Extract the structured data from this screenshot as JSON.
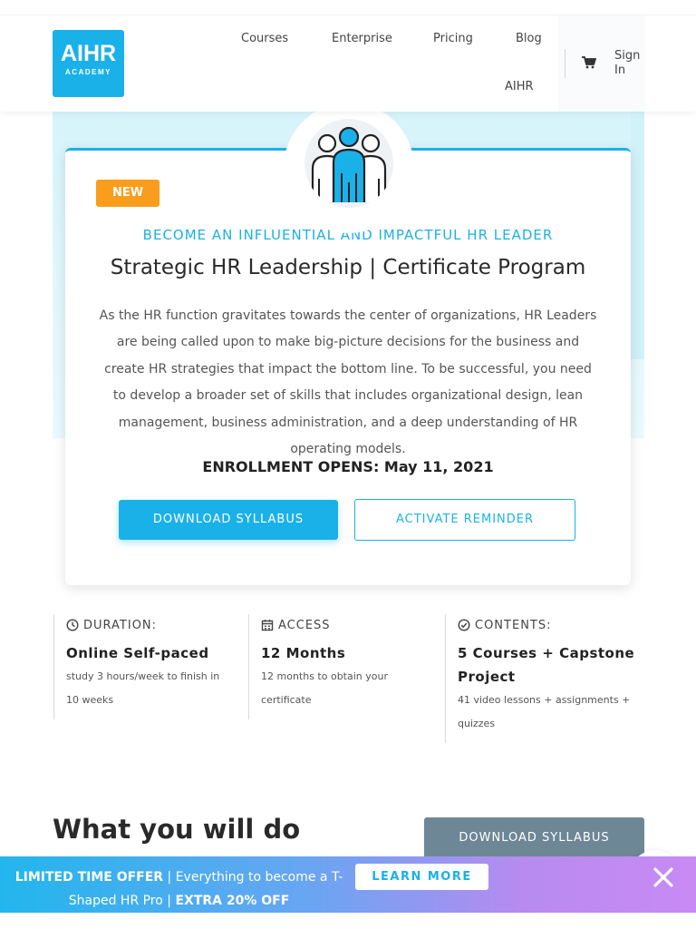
{
  "header": {
    "logo_main": "AIHR",
    "logo_sub": "ACADEMY",
    "nav": [
      "Courses",
      "Enterprise",
      "Pricing",
      "Blog",
      "AIHR"
    ],
    "signin": "Sign In",
    "cart_icon": "cart-icon"
  },
  "hero": {
    "badge": "NEW",
    "eyebrow": "BECOME AN INFLUENTIAL AND IMPACTFUL HR LEADER",
    "title": "Strategic HR Leadership | Certificate Program",
    "description": "As the HR function gravitates towards the center of organizations, HR Leaders are being called upon to make big-picture decisions for the business and create HR strategies that impact the bottom line. To be successful, you need to develop a broader set of skills that includes organizational design, lean management, business administration, and a deep understanding of HR operating models.",
    "enroll_label": "ENROLLMENT OPENS: May 11, 2021",
    "primary_button": "DOWNLOAD SYLLABUS",
    "secondary_button": "ACTIVATE REMINDER",
    "illustration_icon": "team-leader-icon"
  },
  "features": [
    {
      "icon": "clock-icon",
      "label": "DURATION:",
      "value": "Online Self-paced",
      "sub": "study 3 hours/week to finish in 10 weeks"
    },
    {
      "icon": "calendar-icon",
      "label": "ACCESS",
      "value": "12 Months",
      "sub": "12 months to obtain your certificate"
    },
    {
      "icon": "check-circle-icon",
      "label": "CONTENTS:",
      "value": "5 Courses + Capstone Project",
      "sub": "41 video lessons + assignments + quizzes"
    }
  ],
  "section": {
    "heading": "What you will do",
    "button": "DOWNLOAD SYLLABUS"
  },
  "offer_bar": {
    "strong1": "LIMITED TIME OFFER",
    "text": " | Everything to become a T-Shaped HR Pro | ",
    "strong2": "EXTRA 20% OFF",
    "button": "LEARN MORE",
    "close_icon": "close-icon"
  },
  "colors": {
    "brand": "#1ab1e8",
    "badge": "#f99d1c",
    "secondary_button": "#6e8796"
  }
}
